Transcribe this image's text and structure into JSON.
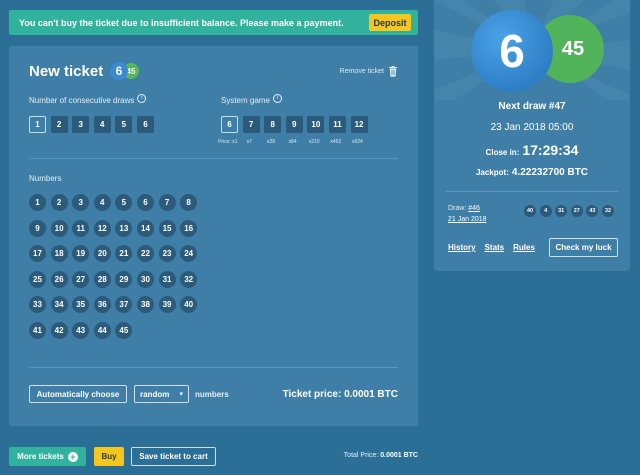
{
  "alert": {
    "message": "You can't buy the ticket due to insufficient balance. Please make a payment.",
    "deposit_label": "Deposit"
  },
  "ticket": {
    "title": "New ticket",
    "logo_main": "6",
    "logo_sub": "45",
    "remove_label": "Remove ticket",
    "consecutive_label": "Number of consecutive draws",
    "consecutive_options": [
      "1",
      "2",
      "3",
      "4",
      "5",
      "6"
    ],
    "consecutive_selected": "1",
    "system_label": "System game",
    "system_options": [
      "6",
      "7",
      "8",
      "9",
      "10",
      "11",
      "12"
    ],
    "system_selected": "6",
    "system_prices": [
      "Price: x1",
      "x7",
      "x28",
      "x84",
      "x210",
      "x462",
      "x924"
    ],
    "numbers_label": "Numbers",
    "numbers": [
      "1",
      "2",
      "3",
      "4",
      "5",
      "6",
      "7",
      "8",
      "9",
      "10",
      "11",
      "12",
      "13",
      "14",
      "15",
      "16",
      "17",
      "18",
      "19",
      "20",
      "21",
      "22",
      "23",
      "24",
      "25",
      "26",
      "27",
      "28",
      "29",
      "30",
      "31",
      "32",
      "33",
      "34",
      "35",
      "36",
      "37",
      "38",
      "39",
      "40",
      "41",
      "42",
      "43",
      "44",
      "45"
    ],
    "auto_choose_label": "Automatically choose",
    "random_select_value": "random",
    "numbers_suffix": "numbers",
    "price_label": "Ticket price: 0.0001 BTC"
  },
  "draw": {
    "ball_main": "6",
    "ball_sub": "45",
    "next_draw": "Next draw #47",
    "date": "23 Jan 2018 05:00",
    "close_label": "Close in:",
    "close_time": "17:29:34",
    "jackpot_label": "Jackpot:",
    "jackpot_value": "4.22232700 BTC",
    "prev_label": "Draw:",
    "prev_number": "#46",
    "prev_date": "21 Jan 2018",
    "prev_balls": [
      "40",
      "4",
      "31",
      "27",
      "43",
      "32"
    ],
    "links": [
      "History",
      "Stats",
      "Rules"
    ],
    "luck_label": "Check my luck"
  },
  "footer": {
    "more_tickets": "More tickets",
    "buy": "Buy",
    "save_cart": "Save ticket to cart",
    "total_label": "Total Price:",
    "total_value": "0.0001 BTC"
  },
  "colors": {
    "background": "#2b6f97",
    "panel": "#3f7ea6",
    "alert": "#30b29c",
    "accent_yellow": "#f5c61d",
    "ball_blue": "#2f7fc6",
    "ball_green": "#52b45a",
    "number_dark": "#2c5a7a"
  }
}
